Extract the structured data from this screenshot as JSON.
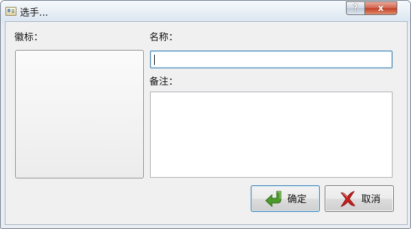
{
  "window": {
    "title": "选手...",
    "help_glyph": "?",
    "close_glyph": "x"
  },
  "form": {
    "logo_label": "徽标：",
    "name_label": "名称：",
    "name_value": "",
    "notes_label": "备注：",
    "notes_value": ""
  },
  "buttons": {
    "ok_label": "确定",
    "cancel_label": "取消"
  },
  "icons": {
    "ok": "green-return-arrow-icon",
    "cancel": "red-x-icon"
  },
  "colors": {
    "focus_border": "#3c7fb1",
    "ok_icon": "#4e9a2c",
    "cancel_icon": "#c81e1e"
  }
}
